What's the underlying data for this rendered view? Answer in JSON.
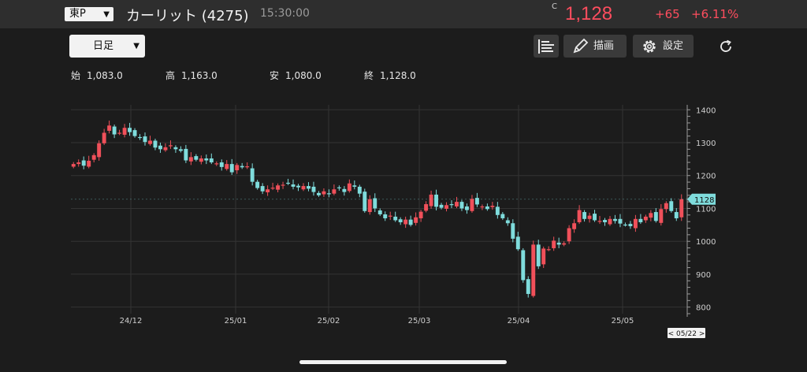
{
  "header": {
    "market": "東P",
    "title": "カーリット (4275)",
    "time": "15:30:00",
    "price_prefix": "C",
    "price": "1,128",
    "change": "+65",
    "change_pct": "+6.11%"
  },
  "toolbar": {
    "period": "日足",
    "draw_label": "描画",
    "settings_label": "設定"
  },
  "ohlc": {
    "open_label": "始",
    "open": "1,083.0",
    "high_label": "高",
    "high": "1,163.0",
    "low_label": "安",
    "low": "1,080.0",
    "close_label": "終",
    "close": "1,128.0"
  },
  "colors": {
    "up": "#f0505a",
    "down": "#7fdcdc",
    "price_text": "#ff4d5e"
  },
  "chart_data": {
    "type": "candlestick",
    "y_ticks": [
      1400,
      1300,
      1200,
      1100,
      1000,
      900,
      800
    ],
    "ylim": [
      780,
      1415
    ],
    "x_labels": [
      "24/12",
      "25/01",
      "25/02",
      "25/03",
      "25/04",
      "25/05"
    ],
    "last_price_tag": "1128",
    "cursor_date_label": "< 05/22 >",
    "grid": true,
    "closes": [
      1235,
      1240,
      1230,
      1245,
      1262,
      1298,
      1330,
      1352,
      1325,
      1330,
      1345,
      1332,
      1320,
      1316,
      1302,
      1306,
      1285,
      1280,
      1286,
      1292,
      1280,
      1275,
      1246,
      1256,
      1248,
      1252,
      1246,
      1240,
      1237,
      1226,
      1235,
      1210,
      1232,
      1225,
      1228,
      1181,
      1162,
      1152,
      1158,
      1163,
      1170,
      1172,
      1176,
      1166,
      1164,
      1168,
      1160,
      1150,
      1140,
      1152,
      1145,
      1158,
      1162,
      1150,
      1176,
      1166,
      1145,
      1092,
      1128,
      1100,
      1082,
      1070,
      1078,
      1064,
      1058,
      1066,
      1050,
      1073,
      1090,
      1113,
      1142,
      1105,
      1102,
      1110,
      1112,
      1120,
      1100,
      1095,
      1129,
      1112,
      1106,
      1098,
      1108,
      1080,
      1070,
      1055,
      1008,
      976,
      882,
      840,
      990,
      924,
      978,
      976,
      1002,
      990,
      994,
      1040,
      1055,
      1095,
      1068,
      1078,
      1064,
      1062,
      1058,
      1068,
      1062,
      1054,
      1050,
      1046,
      1068,
      1058,
      1075,
      1086,
      1062,
      1098,
      1116,
      1092,
      1070,
      1128
    ]
  }
}
